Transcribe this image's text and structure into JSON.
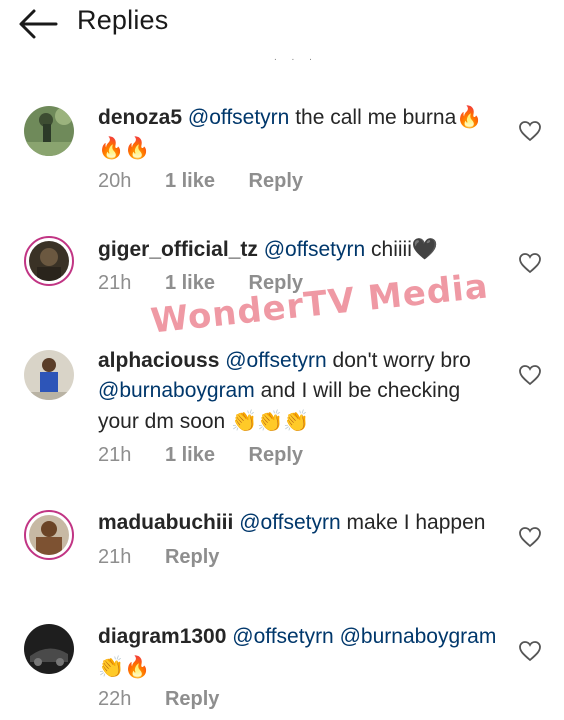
{
  "header": {
    "title": "Replies",
    "back_icon": "arrow-left-icon"
  },
  "more_indicator": ". . .",
  "watermark": "WonderTV Media",
  "comments": [
    {
      "username": "denoza5",
      "mention": "@offsetyrn",
      "text": " the call me burna",
      "emoji": "🔥🔥🔥",
      "time": "20h",
      "likes": "1 like",
      "reply": "Reply"
    },
    {
      "username": "giger_official_tz",
      "mention": "@offsetyrn",
      "text": " chiiii",
      "emoji": "🖤",
      "time": "21h",
      "likes": "1 like",
      "reply": "Reply"
    },
    {
      "username": "alphaciouss",
      "mention": "@offsetyrn",
      "text": " don't worry bro",
      "mention2": "@burnaboygram",
      "text2": "  and I will be checking your dm soon",
      "emoji": "👏👏👏",
      "time": "21h",
      "likes": "1 like",
      "reply": "Reply"
    },
    {
      "username": "maduabuchiii",
      "mention": "@offsetyrn",
      "text": " make I happen",
      "time": "21h",
      "reply": "Reply"
    },
    {
      "username": "diagram1300",
      "mention": "@offsetyrn",
      "mention2": "@burnaboygram",
      "emoji": "👏🔥",
      "time": "22h",
      "reply": "Reply"
    }
  ],
  "colors": {
    "mention": "#00376b",
    "meta": "#8e8e8e",
    "story_ring": "#c13584"
  }
}
